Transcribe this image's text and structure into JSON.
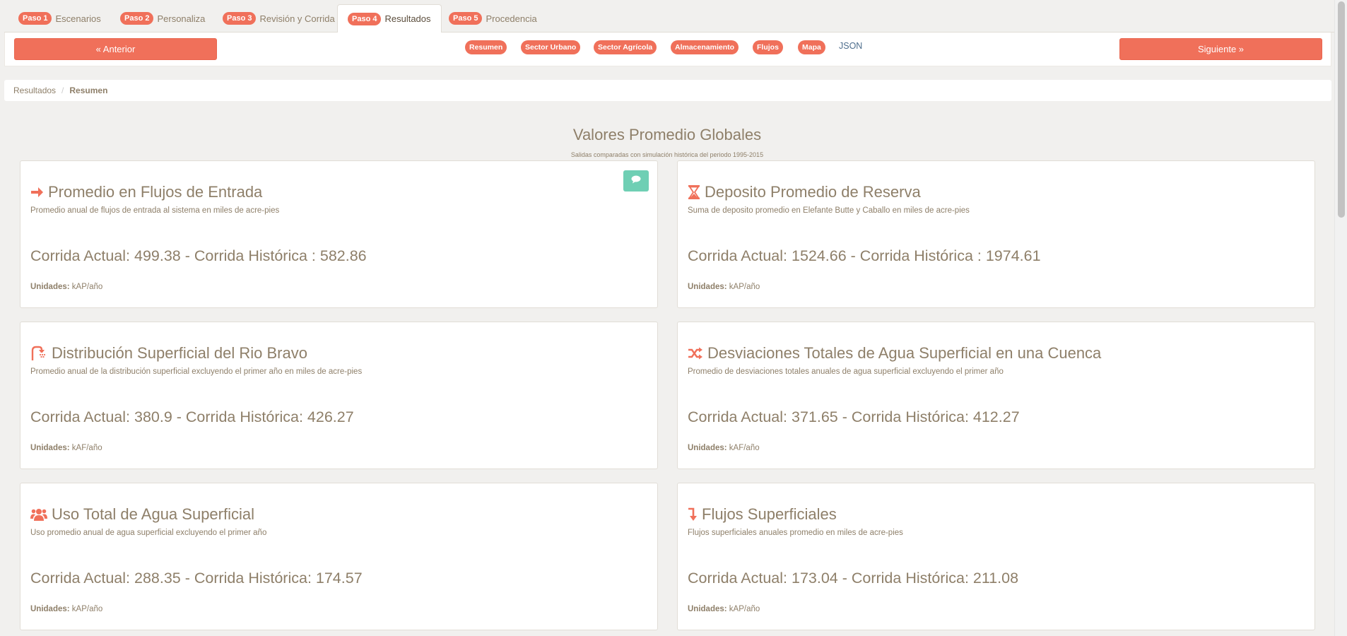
{
  "tabs": [
    {
      "badge": "Paso 1",
      "label": "Escenarios"
    },
    {
      "badge": "Paso 2",
      "label": "Personaliza"
    },
    {
      "badge": "Paso 3",
      "label": "Revisión y Corrida"
    },
    {
      "badge": "Paso 4",
      "label": "Resultados",
      "active": true
    },
    {
      "badge": "Paso 5",
      "label": "Procedencia"
    }
  ],
  "nav": {
    "prev_label": "« Anterior",
    "next_label": "Siguiente »",
    "pills": [
      "Resumen",
      "Sector Urbano",
      "Sector Agrícola",
      "Almacenamiento",
      "Flujos",
      "Mapa"
    ],
    "json_label": "JSON"
  },
  "breadcrumb": {
    "root": "Resultados",
    "separator": "/",
    "current": "Resumen"
  },
  "header": {
    "title": "Valores Promedio Globales",
    "subtitle": "Salidas comparadas con simulación histórica del periodo 1995-2015"
  },
  "units_label": "Unidades:",
  "cards": [
    {
      "icon": "arrow-right-icon",
      "title": "Promedio en Flujos de Entrada",
      "description": "Promedio anual de flujos de entrada al sistema en miles de acre-pies",
      "values": "Corrida Actual: 499.38 - Corrida Histórica : 582.86",
      "units": "kAP/año"
    },
    {
      "icon": "hourglass-icon",
      "title": "Deposito Promedio de Reserva",
      "description": "Suma de deposito promedio en Elefante Butte y Caballo en miles de acre-pies",
      "values": "Corrida Actual: 1524.66 - Corrida Histórica : 1974.61",
      "units": "kAP/año"
    },
    {
      "icon": "shower-icon",
      "title": "Distribución Superficial del Rio Bravo",
      "description": "Promedio anual de la distribución superficial excluyendo el primer año en miles de acre-pies",
      "values": "Corrida Actual: 380.9 - Corrida Histórica: 426.27",
      "units": "kAF/año"
    },
    {
      "icon": "shuffle-icon",
      "title": "Desviaciones Totales de Agua Superficial en una Cuenca",
      "description": "Promedio de desviaciones totales anuales de agua superficial excluyendo el primer año",
      "values": "Corrida Actual: 371.65 - Corrida Histórica: 412.27",
      "units": "kAF/año"
    },
    {
      "icon": "users-icon",
      "title": "Uso Total de Agua Superficial",
      "description": "Uso promedio anual de agua superficial excluyendo el primer año",
      "values": "Corrida Actual: 288.35 - Corrida Histórica: 174.57",
      "units": "kAP/año"
    },
    {
      "icon": "level-down-icon",
      "title": "Flujos Superficiales",
      "description": "Flujos superficiales anuales promedio en miles de acre-pies",
      "values": "Corrida Actual: 173.04 - Corrida Histórica: 211.08",
      "units": "kAP/año"
    }
  ],
  "colors": {
    "accent": "#f0705a",
    "comment": "#6fcfb4",
    "text": "#8e7f69",
    "background": "#f1f0ee"
  }
}
